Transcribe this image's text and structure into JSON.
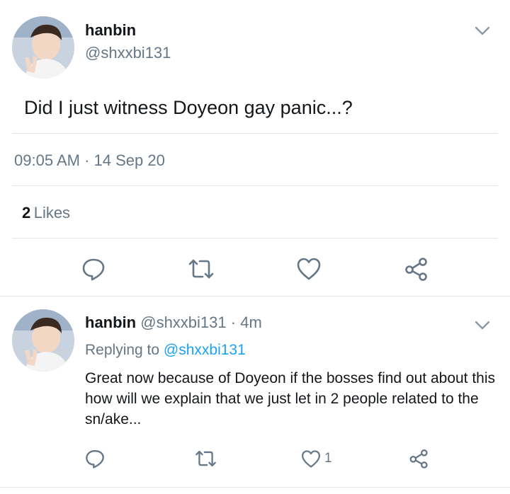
{
  "main_tweet": {
    "display_name": "hanbin",
    "handle": "@shxxbi131",
    "text": "Did I just witness Doyeon gay panic...?",
    "time": "09:05 AM",
    "separator": "·",
    "date": "14 Sep 20",
    "likes_count": "2",
    "likes_label": "Likes",
    "actions": [
      "reply-icon",
      "retweet-icon",
      "like-icon",
      "share-icon"
    ]
  },
  "reply_tweet": {
    "display_name": "hanbin",
    "handle": "@shxxbi131",
    "dot": "·",
    "age": "4m",
    "replying_prefix": "Replying to",
    "replying_mention": "@shxxbi131",
    "text": "Great now because of Doyeon if the bosses find out about this how will we explain that we just let in 2 people related to the sn/ake...",
    "like_count": "1",
    "actions": [
      "reply-icon",
      "retweet-icon",
      "like-icon",
      "share-icon"
    ]
  },
  "colors": {
    "text": "#14171a",
    "secondary": "#657786",
    "accent": "#1da1f2",
    "divider": "#e1e8ed",
    "icon": "#657786"
  }
}
